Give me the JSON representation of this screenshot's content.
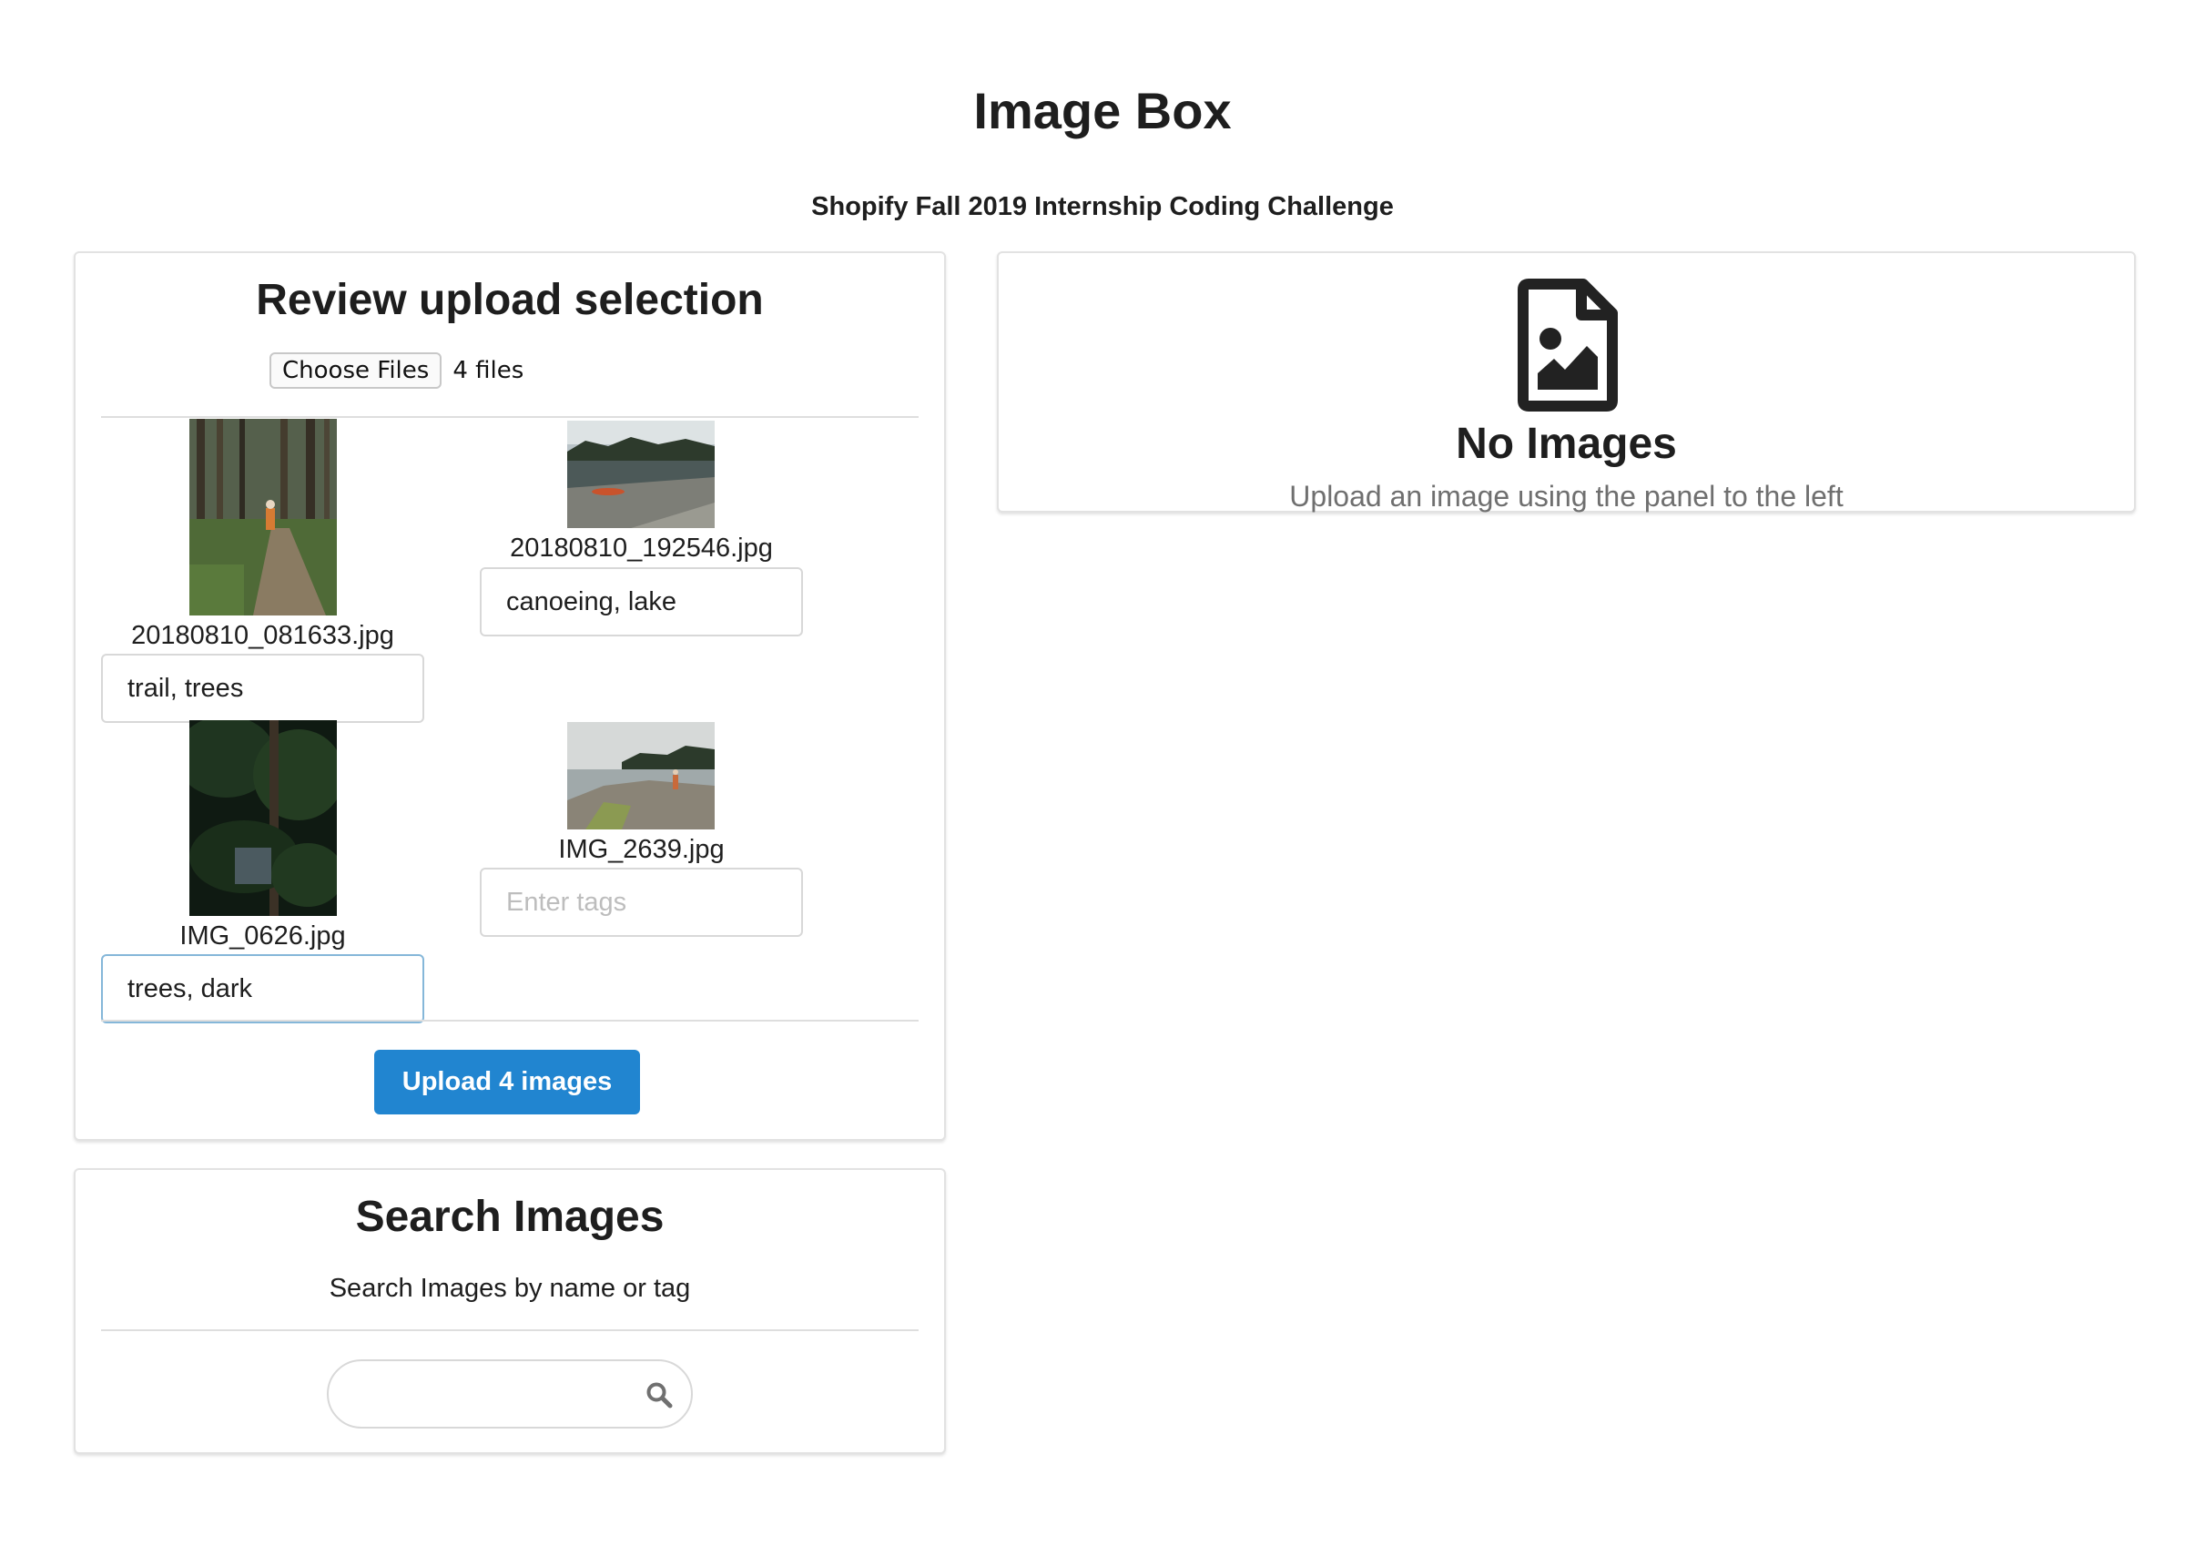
{
  "app": {
    "title": "Image Box",
    "subtitle": "Shopify Fall 2019 Internship Coding Challenge"
  },
  "upload_panel": {
    "title": "Review upload selection",
    "choose_files_label": "Choose Files",
    "file_count": "4 files",
    "images": [
      {
        "filename": "20180810_081633.jpg",
        "tags": "trail, trees",
        "placeholder": "Enter tags"
      },
      {
        "filename": "20180810_192546.jpg",
        "tags": "canoeing, lake",
        "placeholder": "Enter tags"
      },
      {
        "filename": "IMG_0626.jpg",
        "tags": "trees, dark",
        "placeholder": "Enter tags"
      },
      {
        "filename": "IMG_2639.jpg",
        "tags": "",
        "placeholder": "Enter tags"
      }
    ],
    "upload_button_label": "Upload 4 images"
  },
  "search_panel": {
    "title": "Search Images",
    "description": "Search Images by name or tag",
    "query": "",
    "search_icon": "search-icon"
  },
  "gallery_empty": {
    "icon": "file-image-icon",
    "header": "No Images",
    "message": "Upload an image using the panel to the left"
  },
  "colors": {
    "primary_button": "#2185d0",
    "focus_border": "#85b7d9",
    "muted_text": "#6f6f6f"
  }
}
